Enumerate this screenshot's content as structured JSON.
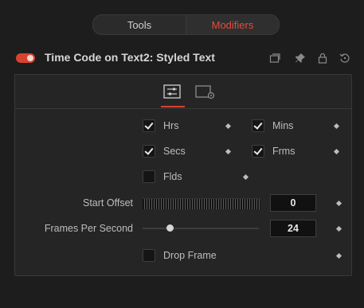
{
  "tabs": [
    {
      "label": "Tools",
      "active": false
    },
    {
      "label": "Modifiers",
      "active": true
    }
  ],
  "header": {
    "title": "Time Code on Text2: Styled Text",
    "enabled": true,
    "icons": [
      "collapse-icon",
      "pin-icon",
      "lock-icon",
      "reset-icon"
    ]
  },
  "panel_tabs": [
    {
      "name": "controls-tab",
      "icon": "sliders-icon",
      "active": true
    },
    {
      "name": "settings-tab",
      "icon": "settings-icon",
      "active": false
    }
  ],
  "controls": {
    "hrs": {
      "label": "Hrs",
      "checked": true
    },
    "mins": {
      "label": "Mins",
      "checked": true
    },
    "secs": {
      "label": "Secs",
      "checked": true
    },
    "frms": {
      "label": "Frms",
      "checked": true
    },
    "flds": {
      "label": "Flds",
      "checked": false
    },
    "start_offset": {
      "label": "Start Offset",
      "value": "0"
    },
    "fps": {
      "label": "Frames Per Second",
      "value": "24"
    },
    "drop_frame": {
      "label": "Drop Frame",
      "checked": false
    }
  },
  "colors": {
    "accent": "#e64b3c",
    "background": "#1d1d1d",
    "panel": "#252525"
  }
}
